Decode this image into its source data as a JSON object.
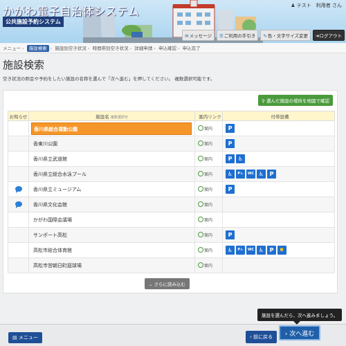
{
  "header": {
    "system_title": "かがわ電子自治体システム",
    "system_subtitle": "公共施設予約システム",
    "user_label": "テスト　利用者 さん",
    "buttons": {
      "message": "メッセージ",
      "guide": "ご利用の手引き",
      "color": "色・文字サイズ変更",
      "logout": "ログアウト"
    }
  },
  "breadcrumb": {
    "menu": "メニュー",
    "steps": [
      "施設検索",
      "施設別空き状況",
      "時間帯別空き状況",
      "詳細申請",
      "申込確認",
      "申込完了"
    ]
  },
  "page_title": "施設検索",
  "instruction": "空き状況の照会や予約をしたい施設の名称を選んで「次へ進む」を押してください。 複数選択可能です。",
  "map_button": "選んだ施設の場所を地図で確認",
  "table": {
    "headers": {
      "notice": "お知らせ",
      "name": "施設名",
      "name_note": "複数選択可",
      "link": "案内リンク",
      "facilities": "付帯設備"
    },
    "link_label": "案内",
    "rows": [
      {
        "name": "香川県総合運動公園",
        "selected": true,
        "notice": false,
        "facilities": [
          "P"
        ]
      },
      {
        "name": "香東川公園",
        "selected": false,
        "notice": false,
        "facilities": [
          "P"
        ]
      },
      {
        "name": "香川県立武道館",
        "selected": false,
        "notice": false,
        "facilities": [
          "P",
          "♿"
        ]
      },
      {
        "name": "香川県立総合水泳プール",
        "selected": false,
        "notice": false,
        "facilities": [
          "♿",
          "P♿",
          "WC",
          "♿",
          "P"
        ]
      },
      {
        "name": "香川県立ミュージアム",
        "selected": false,
        "notice": true,
        "facilities": [
          "P"
        ]
      },
      {
        "name": "香川県文化会館",
        "selected": false,
        "notice": true,
        "facilities": []
      },
      {
        "name": "かがわ国際会議場",
        "selected": false,
        "notice": false,
        "facilities": []
      },
      {
        "name": "サンポート高松",
        "selected": false,
        "notice": false,
        "facilities": [
          "P"
        ]
      },
      {
        "name": "高松市総合体育館",
        "selected": false,
        "notice": false,
        "facilities": [
          "♿",
          "P♿",
          "WC",
          "♿",
          "P",
          "👶"
        ]
      },
      {
        "name": "高松市営朝日町庭球場",
        "selected": false,
        "notice": false,
        "facilities": []
      }
    ]
  },
  "more_button": "さらに読み込む",
  "footer": {
    "menu": "メニュー",
    "back": "前に戻る",
    "next": "次へ進む",
    "tooltip": "施設を選んだら、次へ進みましょう。"
  }
}
